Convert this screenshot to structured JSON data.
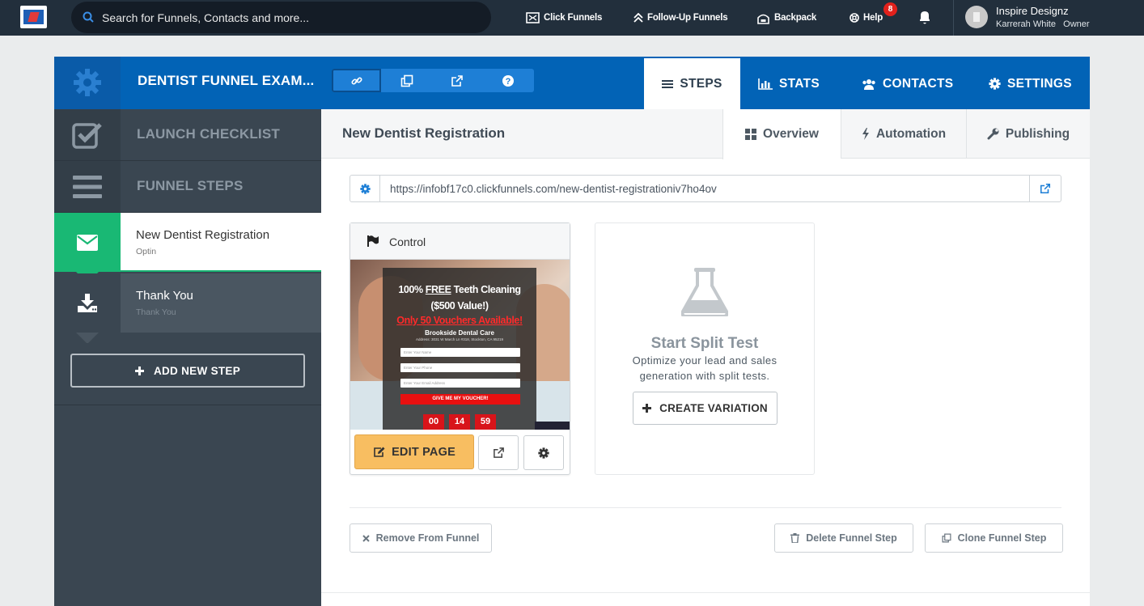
{
  "topbar": {
    "search_placeholder": "Search for Funnels, Contacts and more...",
    "links": [
      {
        "label": "Click Funnels",
        "icon": "clickfunnels-icon"
      },
      {
        "label": "Follow-Up Funnels",
        "icon": "follow-up-icon"
      },
      {
        "label": "Backpack",
        "icon": "backpack-icon"
      },
      {
        "label": "Help",
        "icon": "help-icon"
      }
    ],
    "help_badge": "8",
    "user": {
      "name": "Inspire Designz",
      "role": "Karrerah White   Owner"
    }
  },
  "header": {
    "funnel_title": "DENTIST FUNNEL EXAM...",
    "tabs": [
      {
        "label": "STEPS",
        "active": true
      },
      {
        "label": "STATS"
      },
      {
        "label": "CONTACTS"
      },
      {
        "label": "SETTINGS"
      }
    ]
  },
  "sidebar": {
    "launch_checklist": "LAUNCH CHECKLIST",
    "funnel_steps": "FUNNEL STEPS",
    "steps": [
      {
        "title": "New Dentist Registration",
        "subtitle": "Optin",
        "active": true
      },
      {
        "title": "Thank You",
        "subtitle": "Thank You",
        "active": false
      }
    ],
    "add_step": "ADD NEW STEP"
  },
  "main": {
    "step_title": "New Dentist Registration",
    "subtabs": [
      {
        "label": "Overview",
        "active": true
      },
      {
        "label": "Automation"
      },
      {
        "label": "Publishing"
      }
    ],
    "url": "https://infobf17c0.clickfunnels.com/new-dentist-registrationiv7ho4ov",
    "control": {
      "label": "Control",
      "edit_label": "EDIT PAGE",
      "preview": {
        "line1_pre": "100% ",
        "line1_free": "FREE",
        "line1_post": " Teeth Cleaning",
        "line2": "($500 Value!)",
        "line3": "Only 50 Vouchers Available!",
        "business": "Brookside Dental Care",
        "address": "Address: 3031 W March Ln #318, Stockton, CA 95219",
        "name_ph": "Enter Your Name",
        "phone_ph": "Enter Your Phone",
        "email_ph": "Enter Your Email Address",
        "cta": "GIVE ME MY VOUCHER!",
        "countdown": [
          "00",
          "14",
          "59"
        ]
      }
    },
    "split": {
      "title": "Start Split Test",
      "desc": "Optimize your lead and sales generation with split tests.",
      "button": "CREATE VARIATION"
    },
    "footer": {
      "remove": "Remove From Funnel",
      "delete": "Delete Funnel Step",
      "clone": "Clone Funnel Step"
    }
  },
  "colors": {
    "topbar": "#222f3c",
    "header_blue": "#0263b6",
    "sidebar": "#3a4651",
    "active_step_green": "#19b874",
    "edit_button": "#f8be61",
    "help_badge": "#e2211c"
  }
}
